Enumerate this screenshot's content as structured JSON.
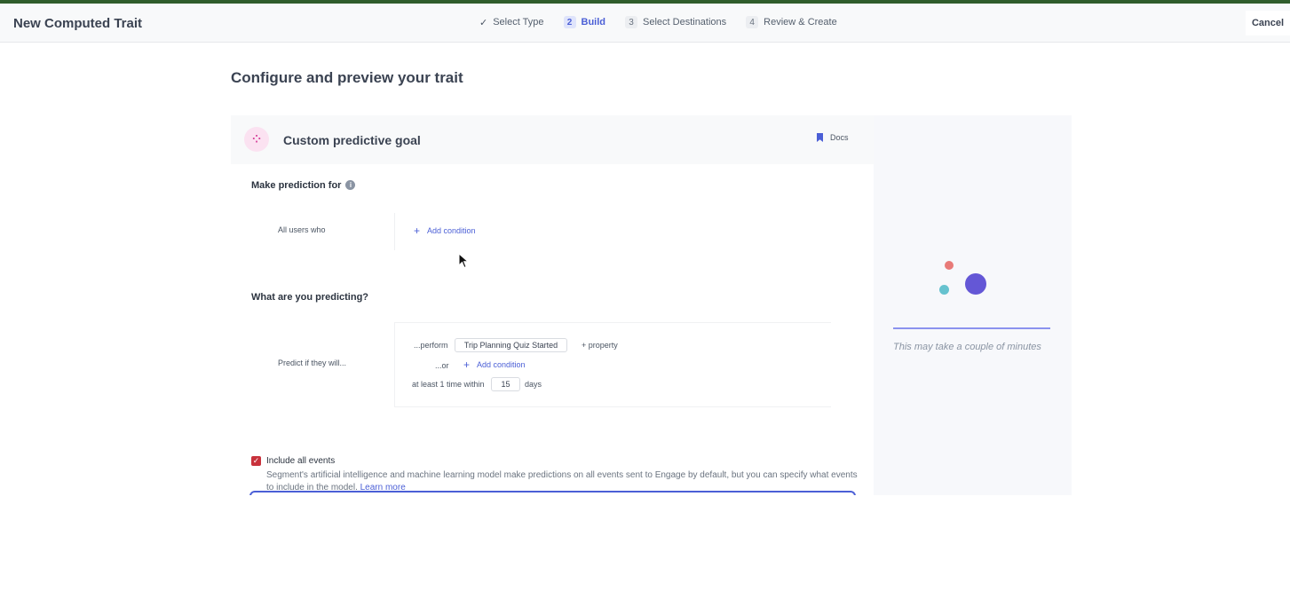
{
  "header": {
    "title": "New Computed Trait",
    "steps": [
      {
        "num": "✓",
        "label": "Select Type"
      },
      {
        "num": "2",
        "label": "Build"
      },
      {
        "num": "3",
        "label": "Select Destinations"
      },
      {
        "num": "4",
        "label": "Review & Create"
      }
    ],
    "cancel_label": "Cancel"
  },
  "page": {
    "title": "Configure and preview your trait"
  },
  "card": {
    "title": "Custom predictive goal",
    "docs_label": "Docs",
    "make_prediction": {
      "label": "Make prediction for",
      "row_label": "All users who",
      "add_condition": "Add condition"
    },
    "predicting": {
      "label": "What are you predicting?",
      "row_label": "Predict if they will...",
      "perform_label": "...perform",
      "event_name": "Trip Planning Quiz Started",
      "property_label": "+ property",
      "or_label": "...or",
      "add_condition": "Add condition",
      "frequency_label": "at least 1 time within",
      "days_value": "15",
      "days_label": "days"
    },
    "include_events": {
      "label": "Include all events",
      "description": "Segment's artificial intelligence and machine learning model make predictions on all events sent to Engage by default, but you can specify what events to include in the model.",
      "learn_more": "Learn more",
      "checked": true
    }
  },
  "preview": {
    "loading_text": "This may take a couple of minutes"
  },
  "colors": {
    "accent": "#4b5fd6",
    "checkbox": "#c8323c",
    "top_bar": "#2f5d2c"
  }
}
